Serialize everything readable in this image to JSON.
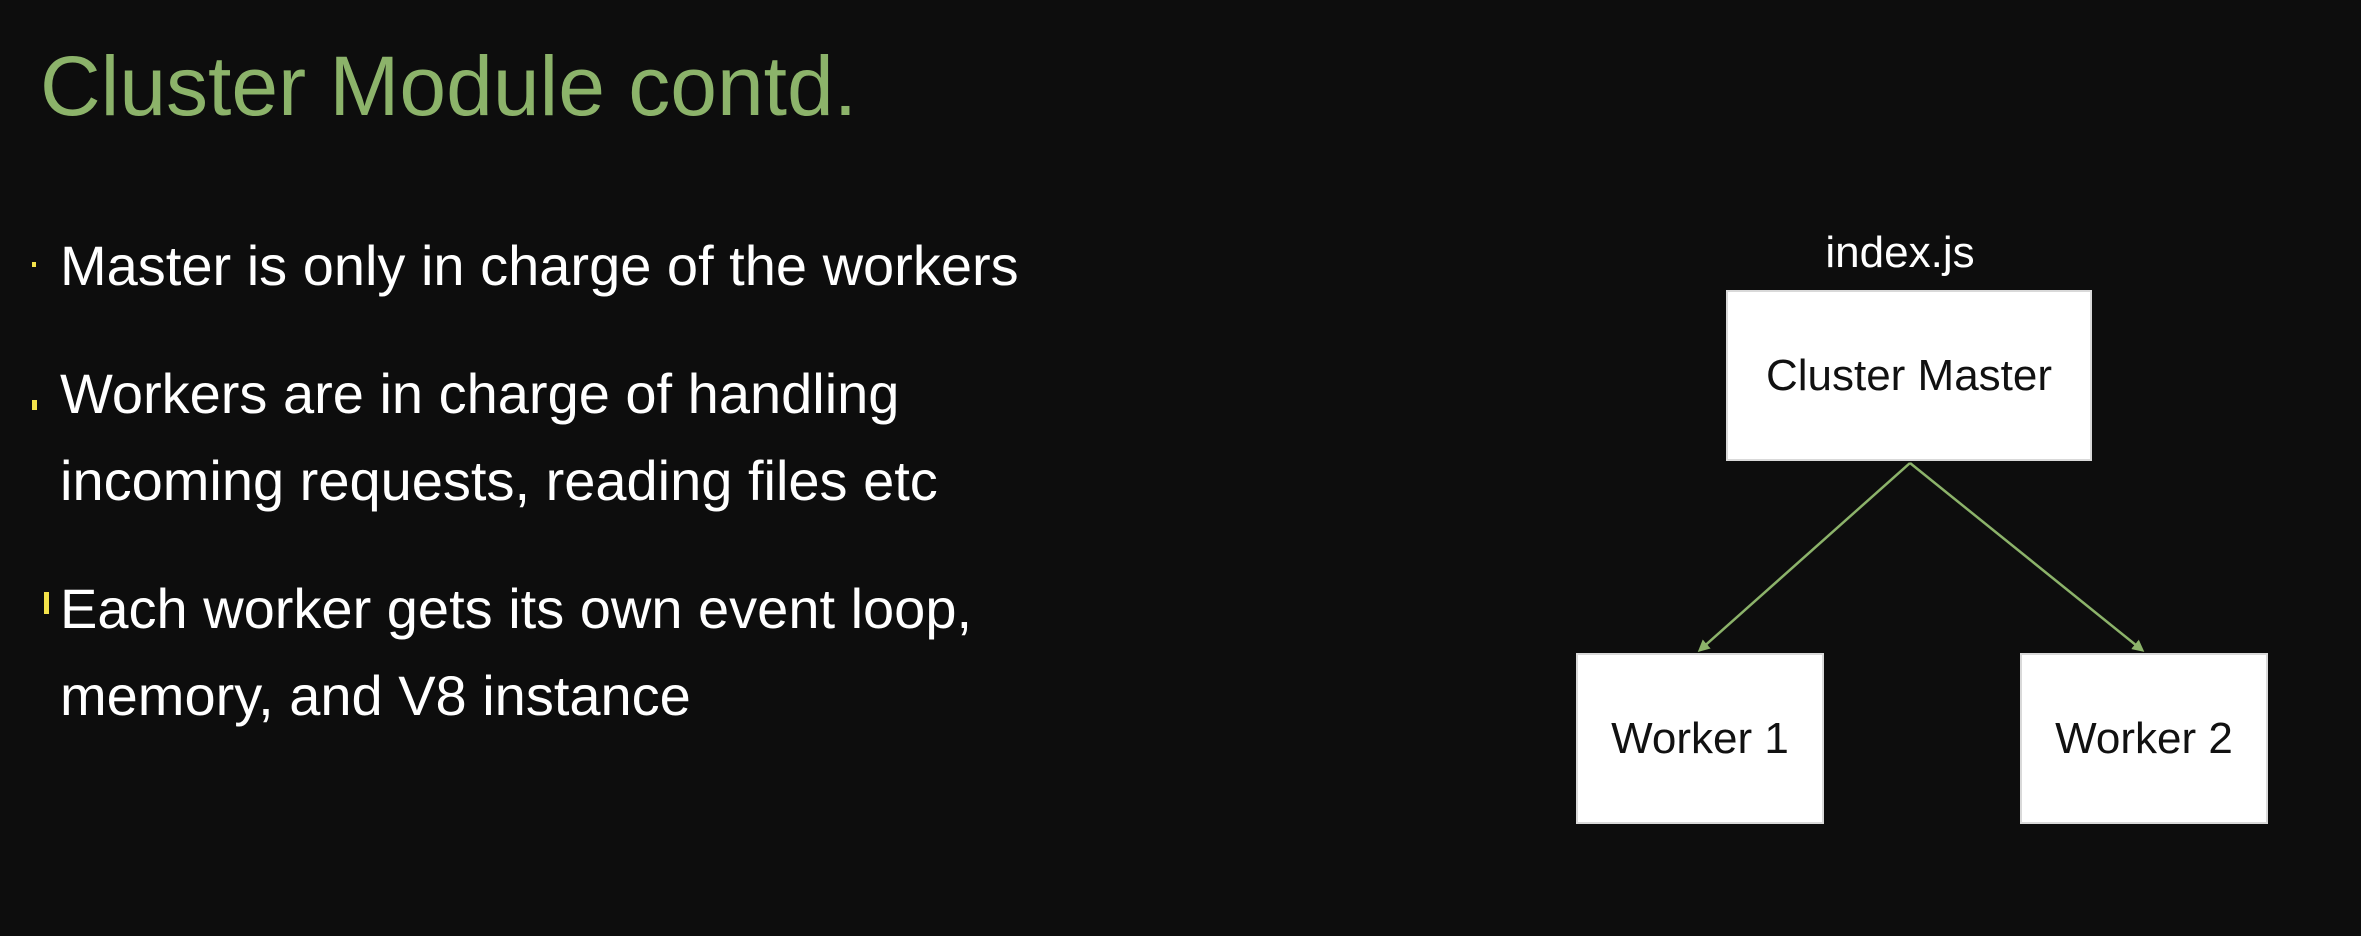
{
  "title": "Cluster Module contd.",
  "bullets": [
    {
      "lines": [
        "Master is only in charge of the workers"
      ]
    },
    {
      "lines": [
        "Workers are in charge of handling",
        "incoming requests, reading files etc"
      ]
    },
    {
      "lines": [
        "Each worker gets its own event loop,",
        "memory, and V8 instance"
      ]
    }
  ],
  "diagram": {
    "file_label": "index.js",
    "master_label": "Cluster Master",
    "workers": [
      "Worker 1",
      "Worker 2"
    ]
  },
  "colors": {
    "background": "#0d0d0d",
    "title": "#8cb36a",
    "arrow": "#8cb36a",
    "bullet_marker": "#f3e24a"
  }
}
